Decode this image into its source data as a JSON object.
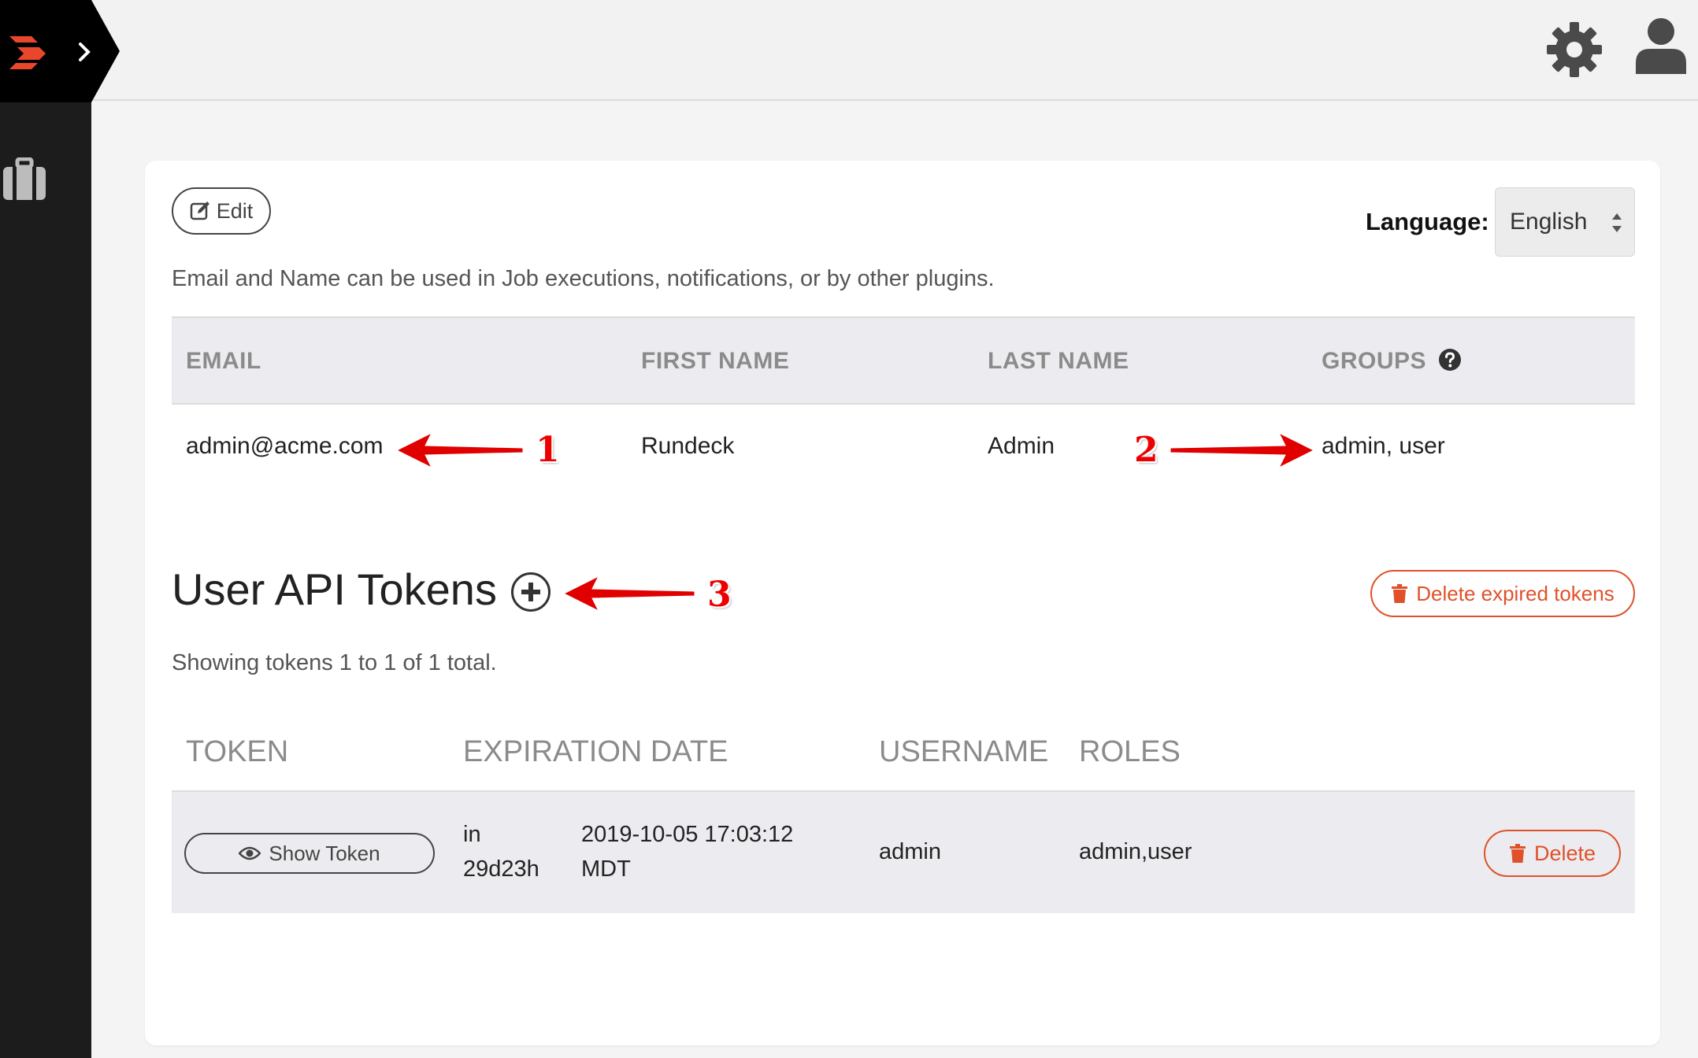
{
  "sidebar": {
    "logo_icon": "rundeck-logo-icon",
    "expand_icon": "chevron-right-icon",
    "projects_icon": "briefcase-icon"
  },
  "topbar": {
    "settings_icon": "gear-icon",
    "user_icon": "user-icon"
  },
  "profile": {
    "edit_label": "Edit",
    "language_label": "Language:",
    "language_value": "English",
    "info_text": "Email and Name can be used in Job executions, notifications, or by other plugins.",
    "columns": [
      "EMAIL",
      "FIRST NAME",
      "LAST NAME",
      "GROUPS"
    ],
    "row": {
      "email": "admin@acme.com",
      "first_name": "Rundeck",
      "last_name": "Admin",
      "groups": "admin, user"
    }
  },
  "tokens": {
    "title": "User API Tokens",
    "delete_expired_label": "Delete expired tokens",
    "showing_text": "Showing tokens 1 to 1 of 1 total.",
    "columns": [
      "TOKEN",
      "EXPIRATION DATE",
      "USERNAME",
      "ROLES"
    ],
    "rows": [
      {
        "show_label": "Show Token",
        "expires_in_line1": "in",
        "expires_in_line2": "29d23h",
        "date_line1": "2019-10-05 17:03:12",
        "date_line2": "MDT",
        "username": "admin",
        "roles": "admin,user",
        "delete_label": "Delete"
      }
    ]
  },
  "annotations": [
    "1",
    "2",
    "3"
  ],
  "colors": {
    "accent": "#e0512a",
    "annotation": "#e00000",
    "sidebar": "#1c1c1c"
  }
}
